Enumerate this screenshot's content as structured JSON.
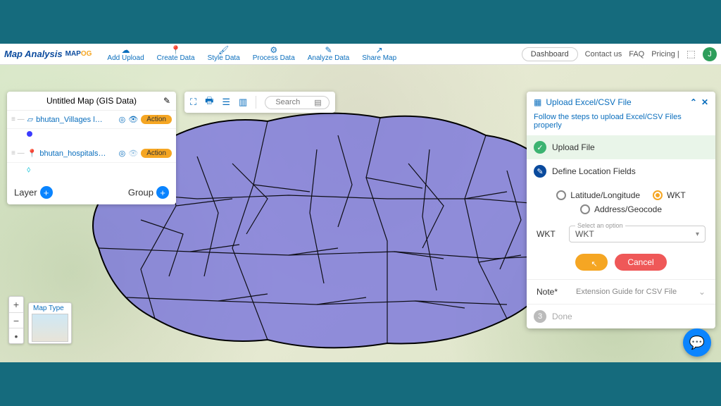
{
  "brand": {
    "line1": "Map Analysis",
    "line2": "MAP",
    "line2b": "OG"
  },
  "menu": [
    {
      "icon": "☁",
      "label": "Add Upload"
    },
    {
      "icon": "📍",
      "label": "Create Data"
    },
    {
      "icon": "🖌",
      "label": "Style Data"
    },
    {
      "icon": "⚙",
      "label": "Process Data"
    },
    {
      "icon": "✎",
      "label": "Analyze Data"
    },
    {
      "icon": "↗",
      "label": "Share Map"
    }
  ],
  "right_menu": {
    "dashboard": "Dashboard",
    "contact": "Contact us",
    "faq": "FAQ",
    "pricing": "Pricing |",
    "avatar": "J"
  },
  "layers": {
    "title": "Untitled Map (GIS Data)",
    "footer_layer": "Layer",
    "footer_group": "Group",
    "items": [
      {
        "icon": "▱",
        "name": "bhutan_Villages l…",
        "action": "Action",
        "sub_type": "dot"
      },
      {
        "icon": "📍",
        "name": "bhutan_hospitals…",
        "action": "Action",
        "sub_type": "pin"
      }
    ]
  },
  "float_tools": {
    "search_placeholder": "Search"
  },
  "maptype_label": "Map Type",
  "upload": {
    "title": "Upload Excel/CSV File",
    "subtitle": "Follow the steps to upload Excel/CSV Files properly",
    "step1": "Upload File",
    "step2": "Define Location Fields",
    "step3": "Done",
    "opt_latlon": "Latitude/Longitude",
    "opt_wkt": "WKT",
    "opt_addr": "Address/Geocode",
    "field_label": "WKT",
    "select_placeholder": "Select an option",
    "select_value": "WKT",
    "btn_cancel": "Cancel",
    "note_label": "Note*",
    "note_text": "Extension Guide for CSV File"
  }
}
